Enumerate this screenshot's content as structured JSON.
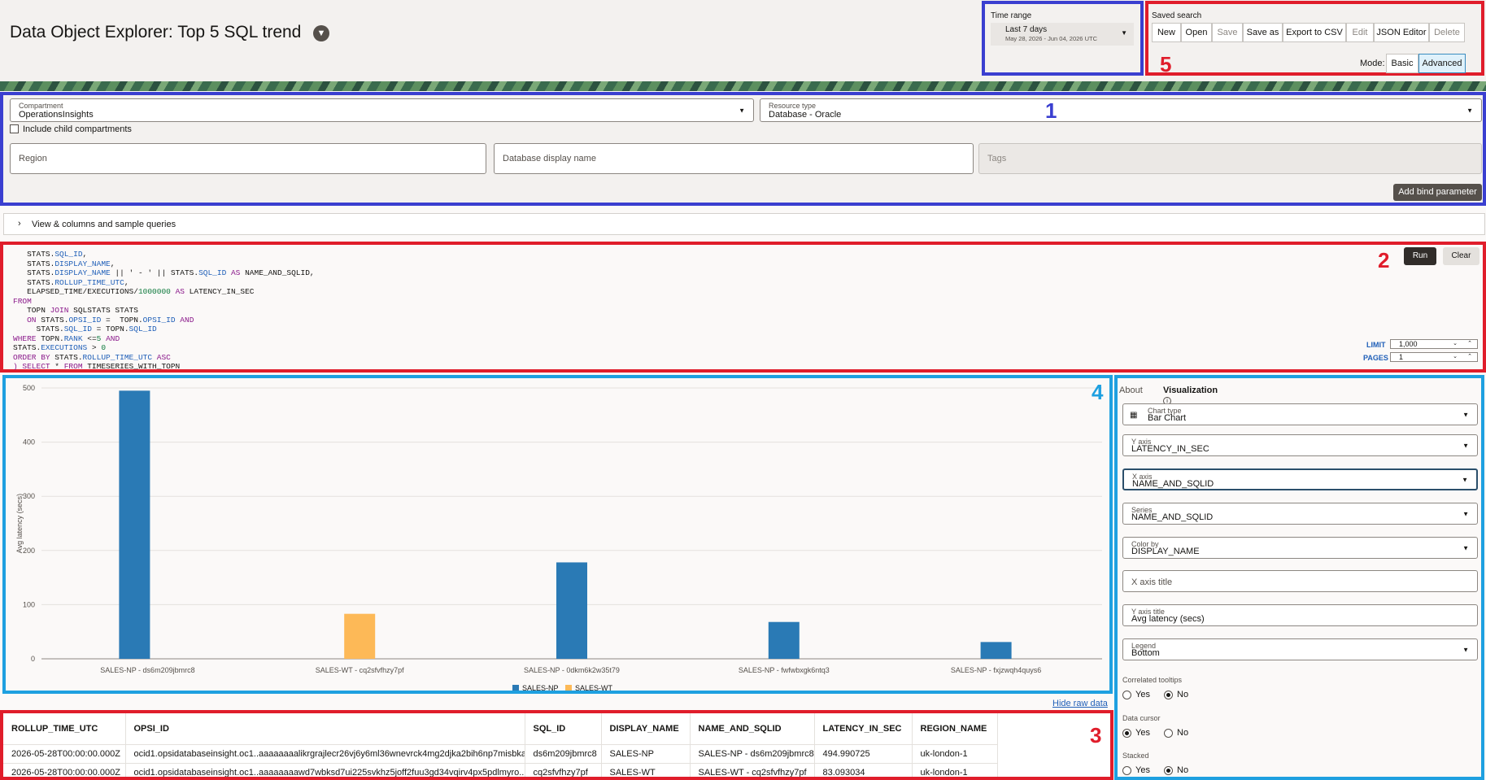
{
  "header": {
    "title": "Data Object Explorer: Top 5 SQL trend"
  },
  "time_range": {
    "label": "Time range",
    "value": "Last 7 days",
    "dates": "May 28, 2026 - Jun 04, 2026 UTC"
  },
  "saved_search": {
    "label": "Saved search",
    "buttons": [
      "New",
      "Open",
      "Save",
      "Save as",
      "Export to CSV",
      "Edit",
      "JSON Editor",
      "Delete"
    ],
    "mode_label": "Mode:",
    "modes": [
      "Basic",
      "Advanced"
    ],
    "selected_mode": "Advanced"
  },
  "annotations": {
    "n1": "1",
    "n2": "2",
    "n3": "3",
    "n4": "4",
    "n5": "5"
  },
  "filters": {
    "compartment_label": "Compartment",
    "compartment_value": "OperationsInsights",
    "resource_label": "Resource type",
    "resource_value": "Database - Oracle",
    "include_child": "Include child compartments",
    "region_placeholder": "Region",
    "db_placeholder": "Database display name",
    "tags_placeholder": "Tags",
    "add_bind": "Add bind parameter"
  },
  "view_columns": "View & columns and sample queries",
  "query": {
    "run": "Run",
    "clear": "Clear",
    "limit_label": "LIMIT",
    "limit_value": "1,000",
    "pages_label": "PAGES",
    "pages_value": "1"
  },
  "chart_data": {
    "type": "bar",
    "categories": [
      "SALES-NP - ds6m209jbmrc8",
      "SALES-WT - cq2sfvfhzy7pf",
      "SALES-NP - 0dkm6k2w35t79",
      "SALES-NP - fwfwbxgk6ntq3",
      "SALES-NP - fxjzwqh4quys6"
    ],
    "series": [
      {
        "name": "SALES-NP",
        "color": "#2a7ab5",
        "values": [
          494.99,
          null,
          178,
          68,
          31
        ]
      },
      {
        "name": "SALES-WT",
        "color": "#fdb957",
        "values": [
          null,
          83.09,
          null,
          null,
          null
        ]
      }
    ],
    "ylabel": "Avg latency (secs)",
    "ylim": [
      0,
      500
    ],
    "yticks": [
      0,
      100,
      200,
      300,
      400,
      500
    ],
    "legend": "bottom"
  },
  "viz": {
    "tab_about": "About",
    "tab_viz": "Visualization",
    "chart_type_label": "Chart type",
    "chart_type": "Bar Chart",
    "y_axis_label": "Y axis",
    "y_axis": "LATENCY_IN_SEC",
    "x_axis_label": "X axis",
    "x_axis": "NAME_AND_SQLID",
    "series_label": "Series",
    "series": "NAME_AND_SQLID",
    "color_by_label": "Color by",
    "color_by": "DISPLAY_NAME",
    "x_title_placeholder": "X axis title",
    "y_title_label": "Y axis title",
    "y_title": "Avg latency (secs)",
    "legend_label": "Legend",
    "legend": "Bottom",
    "correlated_label": "Correlated tooltips",
    "cursor_label": "Data cursor",
    "stacked_label": "Stacked",
    "yes": "Yes",
    "no": "No"
  },
  "hide_raw": "Hide raw data",
  "table": {
    "columns": [
      "ROLLUP_TIME_UTC",
      "OPSI_ID",
      "SQL_ID",
      "DISPLAY_NAME",
      "NAME_AND_SQLID",
      "LATENCY_IN_SEC",
      "REGION_NAME"
    ],
    "rows": [
      [
        "2026-05-28T00:00:00.000Z",
        "ocid1.opsidatabaseinsight.oc1..aaaaaaaalikrgrajlecr26vj6y6ml36wnevrck4mg2djka2bih6np7misbka",
        "ds6m209jbmrc8",
        "SALES-NP",
        "SALES-NP - ds6m209jbmrc8",
        "494.990725",
        "uk-london-1"
      ],
      [
        "2026-05-28T00:00:00.000Z",
        "ocid1.opsidatabaseinsight.oc1..aaaaaaaawd7wbksd7ui225svkhz5joff2fuu3gd34vqirv4px5pdlmyro...",
        "cq2sfvfhzy7pf",
        "SALES-WT",
        "SALES-WT - cq2sfvfhzy7pf",
        "83.093034",
        "uk-london-1"
      ]
    ]
  }
}
